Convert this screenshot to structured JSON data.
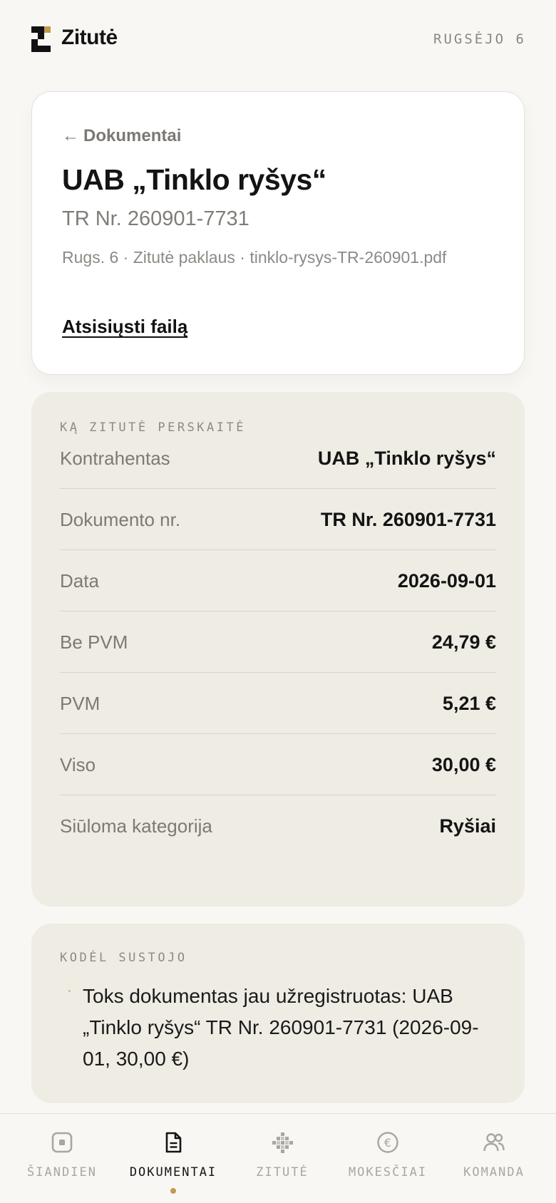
{
  "app": {
    "name": "Zitutė",
    "date_label": "RUGSĖJO 6"
  },
  "document": {
    "back_arrow": "←",
    "back_label": "Dokumentai",
    "title": "UAB „Tinklo ryšys“",
    "subtitle": "TR Nr. 260901-7731",
    "meta": "Rugs. 6 · Zitutė paklaus · tinklo-rysys-TR-260901.pdf",
    "download_label": "Atsisiųsti failą"
  },
  "extracted": {
    "section_title": "KĄ ZITUTĖ PERSKAITĖ",
    "fields": [
      {
        "label": "Kontrahentas",
        "value": "UAB „Tinklo ryšys“"
      },
      {
        "label": "Dokumento nr.",
        "value": "TR Nr. 260901-7731"
      },
      {
        "label": "Data",
        "value": "2026-09-01"
      },
      {
        "label": "Be PVM",
        "value": "24,79 €"
      },
      {
        "label": "PVM",
        "value": "5,21 €"
      },
      {
        "label": "Viso",
        "value": "30,00 €"
      },
      {
        "label": "Siūloma kategorija",
        "value": "Ryšiai"
      }
    ]
  },
  "why_stopped": {
    "section_title": "KODĖL SUSTOJO",
    "bullet": "·",
    "reasons": [
      "Toks dokumentas jau užregistruotas: UAB „Tinklo ryšys“ TR Nr. 260901-7731 (2026-09-01, 30,00 €)"
    ]
  },
  "nav": {
    "items": [
      {
        "label": "ŠIANDIEN",
        "icon": "today-square-icon"
      },
      {
        "label": "DOKUMENTAI",
        "icon": "document-icon",
        "active": true
      },
      {
        "label": "ZITUTĖ",
        "icon": "zitute-pixel-icon"
      },
      {
        "label": "MOKESČIAI",
        "icon": "euro-coin-icon"
      },
      {
        "label": "KOMANDA",
        "icon": "team-people-icon"
      }
    ]
  },
  "colors": {
    "accent": "#c29a4e",
    "background": "#f8f7f4",
    "card_beige": "#efece4",
    "text_dark": "#141414",
    "text_muted": "#7d7a75"
  }
}
